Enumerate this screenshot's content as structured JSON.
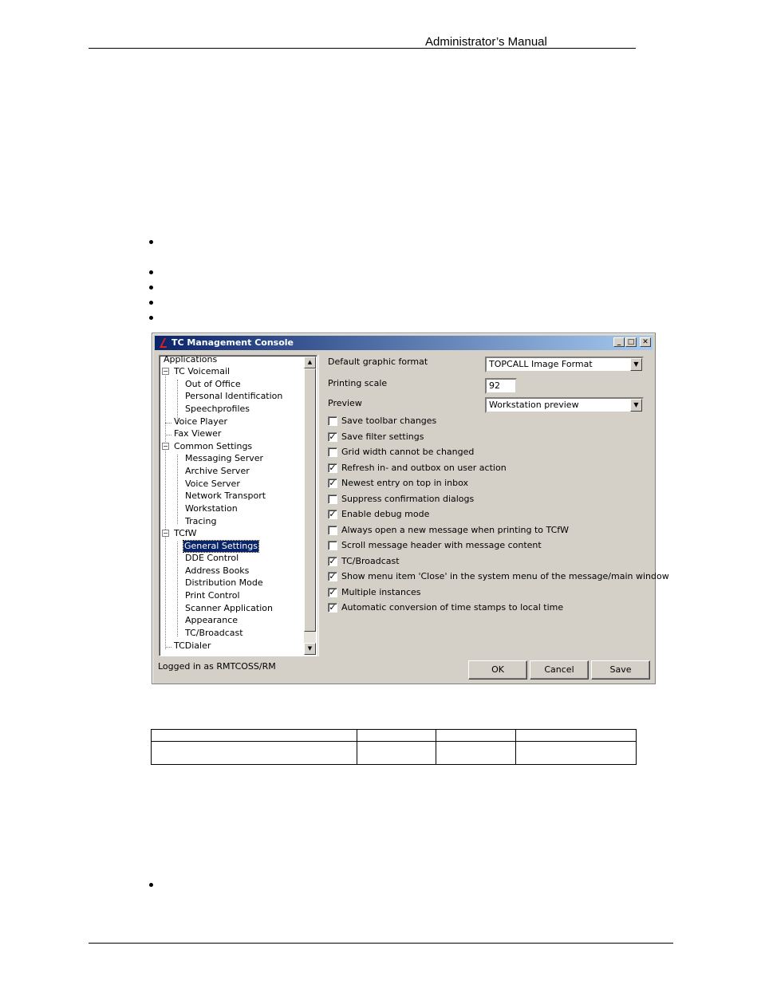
{
  "doc": {
    "header_title": "Administrator’s Manual"
  },
  "window": {
    "title": "TC Management Console",
    "controls": {
      "minimize": "_",
      "maximize": "□",
      "close": "✕"
    },
    "tree": {
      "items": [
        {
          "label": "Applications"
        },
        {
          "label": "TC Voicemail",
          "expander": "−"
        },
        {
          "label": "Out of Office"
        },
        {
          "label": "Personal Identification"
        },
        {
          "label": "Speechprofiles"
        },
        {
          "label": "Voice Player"
        },
        {
          "label": "Fax Viewer"
        },
        {
          "label": "Common Settings",
          "expander": "−"
        },
        {
          "label": "Messaging Server"
        },
        {
          "label": "Archive Server"
        },
        {
          "label": "Voice Server"
        },
        {
          "label": "Network Transport"
        },
        {
          "label": "Workstation"
        },
        {
          "label": "Tracing"
        },
        {
          "label": "TCfW",
          "expander": "−"
        },
        {
          "label": "General Settings",
          "selected": true
        },
        {
          "label": "DDE Control"
        },
        {
          "label": "Address Books"
        },
        {
          "label": "Distribution Mode"
        },
        {
          "label": "Print Control"
        },
        {
          "label": "Scanner Application"
        },
        {
          "label": "Appearance"
        },
        {
          "label": "TC/Broadcast"
        },
        {
          "label": "TCDialer"
        }
      ]
    },
    "settings": {
      "default_graphic_format_label": "Default graphic format",
      "default_graphic_format_value": "TOPCALL Image Format",
      "printing_scale_label": "Printing scale",
      "printing_scale_value": "92",
      "preview_label": "Preview",
      "preview_value": "Workstation preview",
      "checkboxes": [
        {
          "label": "Save toolbar changes",
          "checked": false
        },
        {
          "label": "Save filter settings",
          "checked": true
        },
        {
          "label": "Grid width cannot be changed",
          "checked": false
        },
        {
          "label": "Refresh in- and outbox on user action",
          "checked": true
        },
        {
          "label": "Newest entry on top in inbox",
          "checked": true
        },
        {
          "label": "Suppress confirmation dialogs",
          "checked": false
        },
        {
          "label": "Enable debug mode",
          "checked": true
        },
        {
          "label": "Always open a new message when printing to TCfW",
          "checked": false
        },
        {
          "label": "Scroll message header with message content",
          "checked": false
        },
        {
          "label": "TC/Broadcast",
          "checked": true
        },
        {
          "label": "Show menu item 'Close' in the system menu of the message/main window",
          "checked": true
        },
        {
          "label": "Multiple instances",
          "checked": true
        },
        {
          "label": "Automatic conversion of time stamps to local time",
          "checked": true
        }
      ]
    },
    "status_text": "Logged in as RMTCOSS/RM",
    "buttons": {
      "ok": "OK",
      "cancel": "Cancel",
      "save": "Save"
    }
  }
}
